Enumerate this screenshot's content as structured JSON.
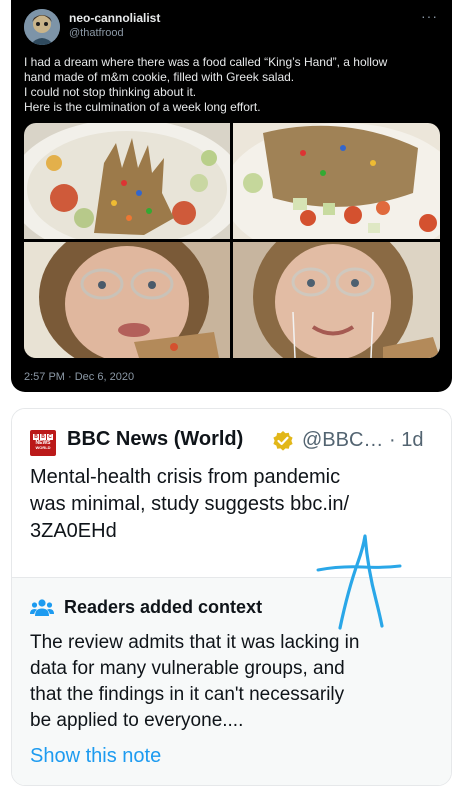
{
  "tweet": {
    "display_name": "neo-cannolialist",
    "handle": "@thatfrood",
    "more_icon": "more-horizontal-icon",
    "text_lines": [
      "I had a dream where there was a food called “King’s Hand”, a hollow",
      "hand made of m&m cookie, filled with Greek salad.",
      "I could not stop thinking about it.",
      "Here is the culmination of a week long effort."
    ],
    "timestamp": "2:57 PM · Dec 6, 2020"
  },
  "quoted": {
    "account_name": "BBC News (World)",
    "handle_time": "@BBC… · 1d",
    "verified_icon": "verified-badge-icon",
    "text_lines": [
      "Mental-health crisis from pandemic",
      "was minimal, study suggests bbc.in/",
      "3ZA0EHd"
    ]
  },
  "context": {
    "icon": "people-icon",
    "title": "Readers added context",
    "text_lines": [
      "The review admits that it was lacking in",
      "data for many vulnerable groups, and",
      "that the findings in it can't necessarily",
      "be applied to everyone...."
    ],
    "show_note_label": "Show this note"
  },
  "colors": {
    "dark_bg": "#000000",
    "link_blue": "#1d9bf0",
    "bbc_red": "#bb1919",
    "handwriting_blue": "#2aa7e8"
  }
}
